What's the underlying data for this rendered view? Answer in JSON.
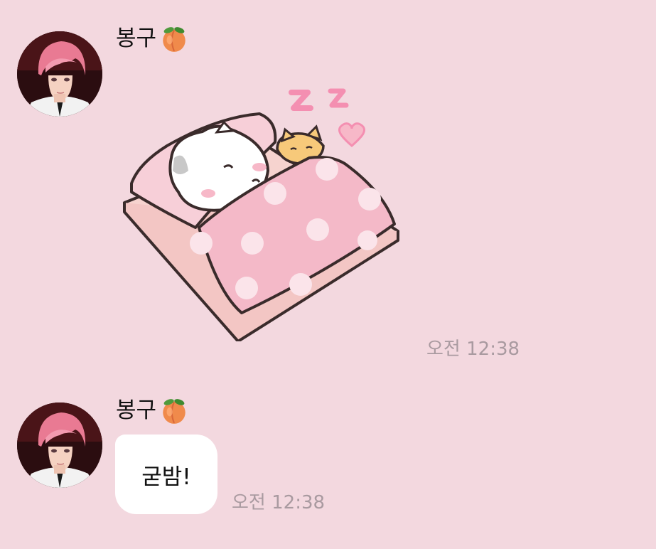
{
  "messages": [
    {
      "sender": "봉구",
      "sender_emoji_icon": "peach-icon",
      "avatar_icon": "pink-haired-man-avatar",
      "type": "sticker",
      "sticker_icon": "sleeping-cats-in-bed-sticker",
      "time": "오전 12:38"
    },
    {
      "sender": "봉구",
      "sender_emoji_icon": "peach-icon",
      "avatar_icon": "pink-haired-man-avatar",
      "type": "text",
      "text": "굳밤!",
      "time": "오전 12:38"
    }
  ],
  "colors": {
    "chat_background": "#f3d8df",
    "bubble_background": "#ffffff",
    "timestamp": "#a99aa0"
  }
}
